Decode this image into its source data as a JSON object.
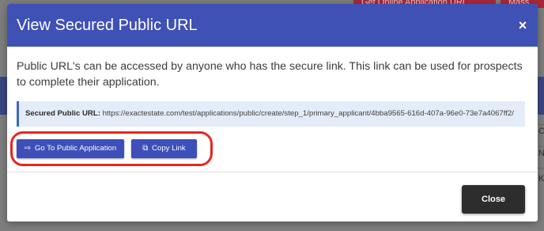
{
  "background": {
    "top_button_1": "Get Online Application URL",
    "top_button_2": "Mass",
    "side_letters": [
      "C",
      "N",
      "K"
    ]
  },
  "modal": {
    "title": "View Secured Public URL",
    "close_icon": "×",
    "description": "Public URL's can be accessed by anyone who has the secure link. This link can be used for prospects to complete their application.",
    "url_label": "Secured Public URL:",
    "url_value": "https://exactestate.com/test/applications/public/create/step_1/primary_applicant/4bba9565-616d-407a-96e0-73e7a4067ff2/",
    "go_button_icon": "⇨",
    "go_button_label": "Go To Public Application",
    "copy_button_icon": "⧉",
    "copy_button_label": "Copy Link",
    "close_button_label": "Close"
  },
  "colors": {
    "header": "#3f51b5",
    "primary_button": "#3d4fb8",
    "close_button": "#2d2d2d",
    "highlight_ring": "#e8261c",
    "url_box_bg": "#e3ecf8",
    "url_box_border": "#3c6bb6"
  }
}
